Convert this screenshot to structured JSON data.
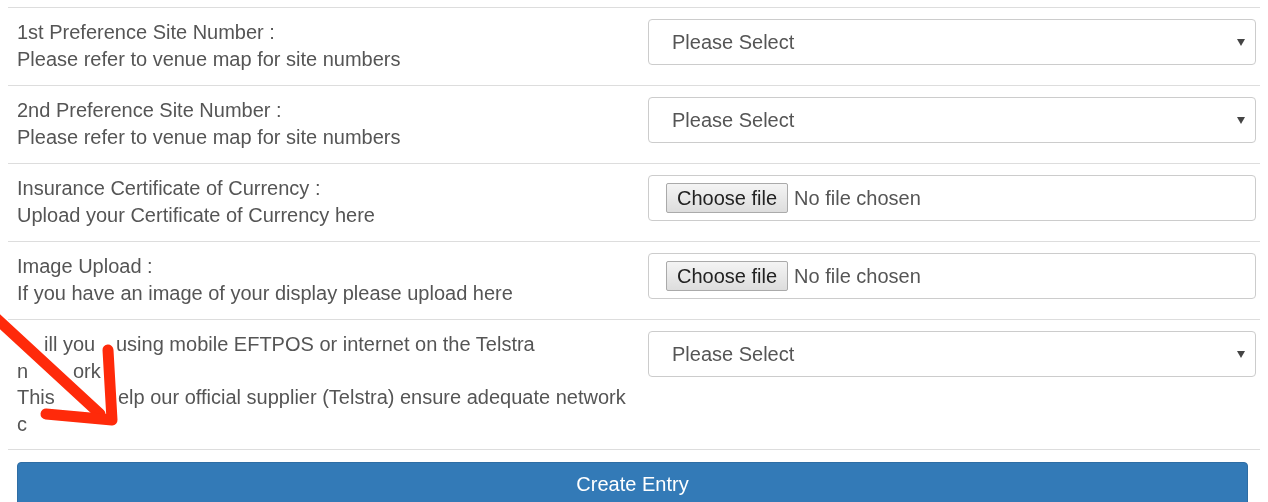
{
  "rows": [
    {
      "title": "1st Preference Site Number :",
      "hint": "Please refer to venue map for site numbers",
      "kind": "select",
      "value": "Please Select"
    },
    {
      "title": "2nd Preference Site Number :",
      "hint": "Please refer to venue map for site numbers",
      "kind": "select",
      "value": "Please Select"
    },
    {
      "title": "Insurance Certificate of Currency :",
      "hint": "Upload your Certificate of Currency here",
      "kind": "file",
      "button": "Choose file",
      "value": "No file chosen"
    },
    {
      "title": "Image Upload :",
      "hint": "If you have an image of your display please upload here",
      "kind": "file",
      "button": "Choose file",
      "value": "No file chosen"
    },
    {
      "lines": [
        [
          "ill you",
          "using mobile EFTPOS or internet on the Telstra"
        ],
        [
          "n",
          "ork"
        ],
        [
          "This",
          "elp our official supplier (Telstra) ensure adequate network"
        ],
        [
          "c"
        ]
      ],
      "kind": "select",
      "value": "Please Select"
    }
  ],
  "submit": "Create Entry"
}
